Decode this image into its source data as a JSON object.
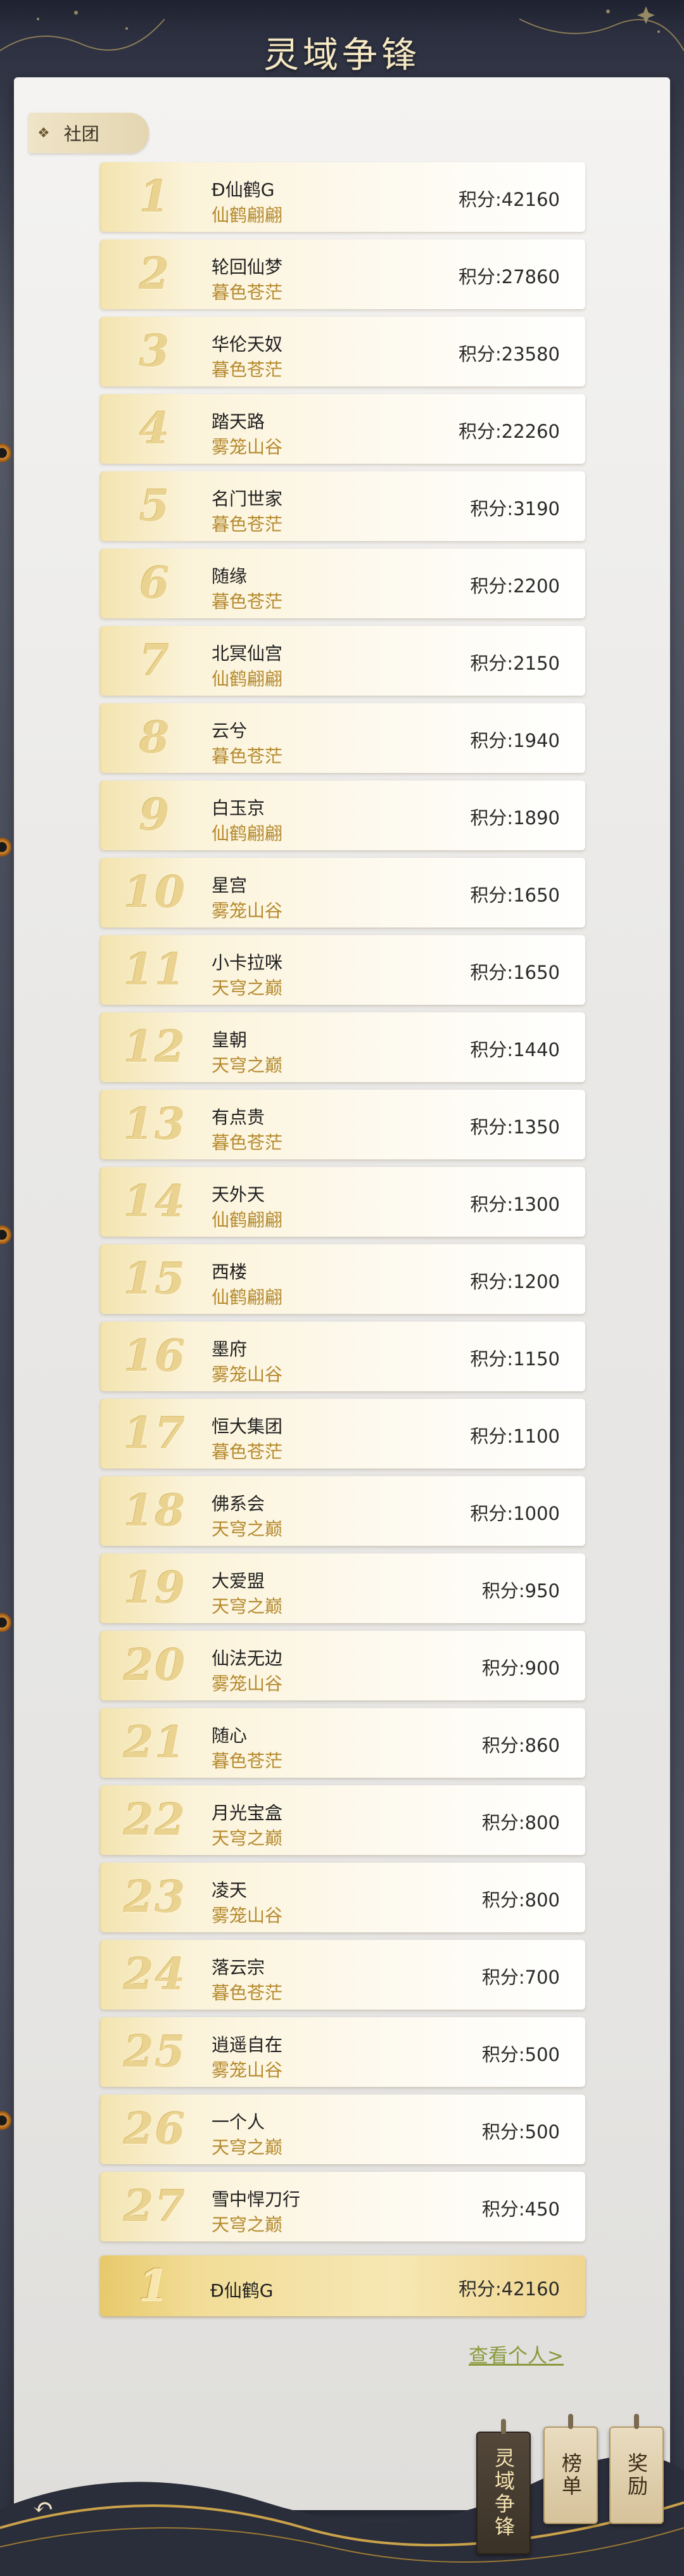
{
  "header": {
    "title": "灵域争锋"
  },
  "tab": {
    "label": "社团"
  },
  "score_prefix": "积分:",
  "rows": [
    {
      "rank": "1",
      "name": "Đ仙鹤G",
      "server": "仙鹤翩翩",
      "score": "积分:42160"
    },
    {
      "rank": "2",
      "name": "轮回仙梦",
      "server": "暮色苍茫",
      "score": "积分:27860"
    },
    {
      "rank": "3",
      "name": "华伦天奴",
      "server": "暮色苍茫",
      "score": "积分:23580"
    },
    {
      "rank": "4",
      "name": "踏天路",
      "server": "雾笼山谷",
      "score": "积分:22260"
    },
    {
      "rank": "5",
      "name": "名门世家",
      "server": "暮色苍茫",
      "score": "积分:3190"
    },
    {
      "rank": "6",
      "name": "随缘",
      "server": "暮色苍茫",
      "score": "积分:2200"
    },
    {
      "rank": "7",
      "name": "北冥仙宫",
      "server": "仙鹤翩翩",
      "score": "积分:2150"
    },
    {
      "rank": "8",
      "name": "云兮",
      "server": "暮色苍茫",
      "score": "积分:1940"
    },
    {
      "rank": "9",
      "name": "白玉京",
      "server": "仙鹤翩翩",
      "score": "积分:1890"
    },
    {
      "rank": "10",
      "name": "星宫",
      "server": "雾笼山谷",
      "score": "积分:1650"
    },
    {
      "rank": "11",
      "name": "小卡拉咪",
      "server": "天穹之巅",
      "score": "积分:1650"
    },
    {
      "rank": "12",
      "name": "皇朝",
      "server": "天穹之巅",
      "score": "积分:1440"
    },
    {
      "rank": "13",
      "name": "有点贵",
      "server": "暮色苍茫",
      "score": "积分:1350"
    },
    {
      "rank": "14",
      "name": "天外天",
      "server": "仙鹤翩翩",
      "score": "积分:1300"
    },
    {
      "rank": "15",
      "name": "西楼",
      "server": "仙鹤翩翩",
      "score": "积分:1200"
    },
    {
      "rank": "16",
      "name": "墨府",
      "server": "雾笼山谷",
      "score": "积分:1150"
    },
    {
      "rank": "17",
      "name": "恒大集团",
      "server": "暮色苍茫",
      "score": "积分:1100"
    },
    {
      "rank": "18",
      "name": "佛系会",
      "server": "天穹之巅",
      "score": "积分:1000"
    },
    {
      "rank": "19",
      "name": "大爱盟",
      "server": "天穹之巅",
      "score": "积分:950"
    },
    {
      "rank": "20",
      "name": "仙法无边",
      "server": "雾笼山谷",
      "score": "积分:900"
    },
    {
      "rank": "21",
      "name": "随心",
      "server": "暮色苍茫",
      "score": "积分:860"
    },
    {
      "rank": "22",
      "name": "月光宝盒",
      "server": "天穹之巅",
      "score": "积分:800"
    },
    {
      "rank": "23",
      "name": "凌天",
      "server": "雾笼山谷",
      "score": "积分:800"
    },
    {
      "rank": "24",
      "name": "落云宗",
      "server": "暮色苍茫",
      "score": "积分:700"
    },
    {
      "rank": "25",
      "name": "逍遥自在",
      "server": "雾笼山谷",
      "score": "积分:500"
    },
    {
      "rank": "26",
      "name": "一个人",
      "server": "天穹之巅",
      "score": "积分:500"
    },
    {
      "rank": "27",
      "name": "雪中悍刀行",
      "server": "天穹之巅",
      "score": "积分:450"
    }
  ],
  "my_rank": {
    "rank": "1",
    "name": "Đ仙鹤G",
    "score": "积分:42160"
  },
  "view_personal": "查看个人>",
  "side_tabs": [
    {
      "label": "灵域争锋",
      "active": true
    },
    {
      "label": "榜单",
      "active": false
    },
    {
      "label": "奖励",
      "active": false
    }
  ],
  "icons": {
    "back": "back-arrow-icon",
    "tab": "diamond-icon"
  },
  "colors": {
    "gold": "#b58a2e",
    "link": "#8a9a3e",
    "title": "#f6e8c3"
  }
}
